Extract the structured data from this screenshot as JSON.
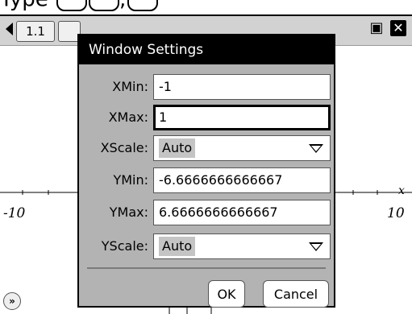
{
  "instruction": {
    "text": "Type"
  },
  "tabs": [
    {
      "label": "1.1"
    }
  ],
  "graph": {
    "x_min_label": "-10",
    "x_max_label": "10",
    "x_axis_label": "x"
  },
  "dialog": {
    "title": "Window Settings",
    "fields": {
      "xmin": {
        "label": "XMin:",
        "value": "-1"
      },
      "xmax": {
        "label": "XMax:",
        "value": "1"
      },
      "xscale": {
        "label": "XScale:",
        "value": "Auto"
      },
      "ymin": {
        "label": "YMin:",
        "value": "-6.6666666666667"
      },
      "ymax": {
        "label": "YMax:",
        "value": "6.6666666666667"
      },
      "yscale": {
        "label": "YScale:",
        "value": "Auto"
      }
    },
    "ok_label": "OK",
    "cancel_label": "Cancel"
  },
  "icons": {
    "doc": "document-icon",
    "close": "close-icon",
    "expand": "expand-icon"
  }
}
